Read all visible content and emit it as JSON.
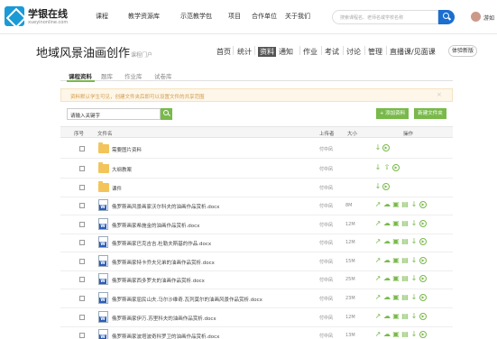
{
  "brand": {
    "title": "学银在线",
    "subtitle": "xueyinonline.com"
  },
  "nav": [
    "课程",
    "教学资源库",
    "示范教学包",
    "项目",
    "合作单位",
    "关于我们"
  ],
  "search": {
    "placeholder": "搜索课程名、老师名或学校名称"
  },
  "user": {
    "name": "游如"
  },
  "course": {
    "title": "地域风景油画创作",
    "portal": "课程门户",
    "tabs": [
      "首页",
      "统计",
      "资料",
      "通知",
      "作业",
      "考试",
      "讨论",
      "管理",
      "直播课/见面课"
    ],
    "active_tab": "资料",
    "trial_label": "体验新版"
  },
  "subtabs": [
    "课程资料",
    "题库",
    "作业库",
    "试卷库"
  ],
  "notice": {
    "text": "资料默认学生可见，创建文件夹后即可以设置文件的共享范围",
    "close": "×"
  },
  "keyword": {
    "placeholder": "请输入关键字"
  },
  "buttons": {
    "add": "+ 添加资料",
    "new_folder": "新建文件夹"
  },
  "table": {
    "headers": {
      "index": "序号",
      "filename": "文件名",
      "uploader": "上传者",
      "size": "大小",
      "ops": "操作"
    },
    "rows": [
      {
        "type": "folder",
        "name": "需要图片资料",
        "uploader": "付中凤",
        "size": ""
      },
      {
        "type": "folder",
        "name": "大纲教案",
        "uploader": "付中凤",
        "size": ""
      },
      {
        "type": "folder",
        "name": "课件",
        "uploader": "付中凤",
        "size": ""
      },
      {
        "type": "doc",
        "name": "俄罗斯画风景画家沃尔科夫的油画作品赏析.docx",
        "uploader": "付中凤",
        "size": "8M"
      },
      {
        "type": "doc",
        "name": "俄罗斯画家希施金的油画作品赏析.docx",
        "uploader": "付中凤",
        "size": "12M"
      },
      {
        "type": "doc",
        "name": "俄罗斯画家巴克吉吉.杜勒夫斯基的作品.docx",
        "uploader": "付中凤",
        "size": "12M"
      },
      {
        "type": "doc",
        "name": "俄罗斯画家特卡乔夫兄弟的油画作品赏析.docx",
        "uploader": "付中凤",
        "size": "15M"
      },
      {
        "type": "doc",
        "name": "俄罗斯画家西多罗夫的油画作品赏析.docx",
        "uploader": "付中凤",
        "size": "25M"
      },
      {
        "type": "doc",
        "name": "俄罗斯画家屈民山夫.马尔沙维奇.瓦列莫尔的油画风景作品赏析.docx",
        "uploader": "付中凤",
        "size": "23M"
      },
      {
        "type": "doc",
        "name": "俄罗斯画家伊万.苏里科夫的油画作品赏析.docx",
        "uploader": "付中凤",
        "size": "12M"
      },
      {
        "type": "doc",
        "name": "俄罗斯画家波塔波奇科罗卫的油画作品赏析.docx",
        "uploader": "付中凤",
        "size": "13M"
      }
    ]
  }
}
